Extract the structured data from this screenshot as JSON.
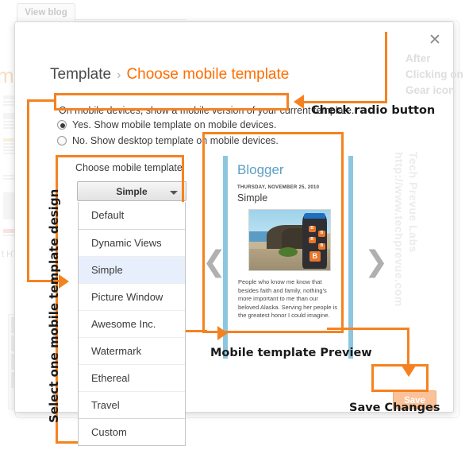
{
  "background": {
    "tab_label": "View blog",
    "heading_fragment": "mp",
    "text_fragment": "t HT"
  },
  "dialog": {
    "close_icon": "close-icon",
    "breadcrumb": {
      "parent": "Template",
      "separator": "›",
      "current": "Choose mobile template"
    },
    "intro_text": "On mobile devices, show a mobile version of your current template.",
    "radio_options": [
      {
        "label": "Yes. Show mobile template on mobile devices.",
        "selected": true
      },
      {
        "label": "No. Show desktop template on mobile devices.",
        "selected": false
      }
    ],
    "choose_label": "Choose mobile template",
    "dropdown": {
      "selected": "Simple",
      "caret_icon": "chevron-down-icon",
      "options": [
        "Default",
        "Dynamic Views",
        "Simple",
        "Picture Window",
        "Awesome Inc.",
        "Watermark",
        "Ethereal",
        "Travel",
        "Custom"
      ]
    },
    "preview": {
      "blog_title": "Blogger",
      "post_date": "THURSDAY, NOVEMBER 25, 2010",
      "post_title": "Simple",
      "photo_alt": "blogger-sticker-bottle-photo",
      "sticker_letter": "B",
      "body_text": "People who know me know that besides faith and family, nothing's more important to me than our beloved Alaska. Serving her people is the greatest honor I could imagine.",
      "prev_icon": "chevron-left-icon",
      "next_icon": "chevron-right-icon",
      "prev_glyph": "❮",
      "next_glyph": "❯"
    },
    "save_label": "Save"
  },
  "watermarks": {
    "after_clicking": "After Clicking on Gear icon",
    "labs": "Tech Prevue Labs",
    "site_url": "http://www.techprevue.com"
  },
  "annotations": {
    "check_radio": "Check radio button",
    "select_template": "Select one mobile template design",
    "mobile_preview": "Mobile template Preview",
    "save_changes": "Save Changes",
    "accent_color": "#f58220"
  }
}
